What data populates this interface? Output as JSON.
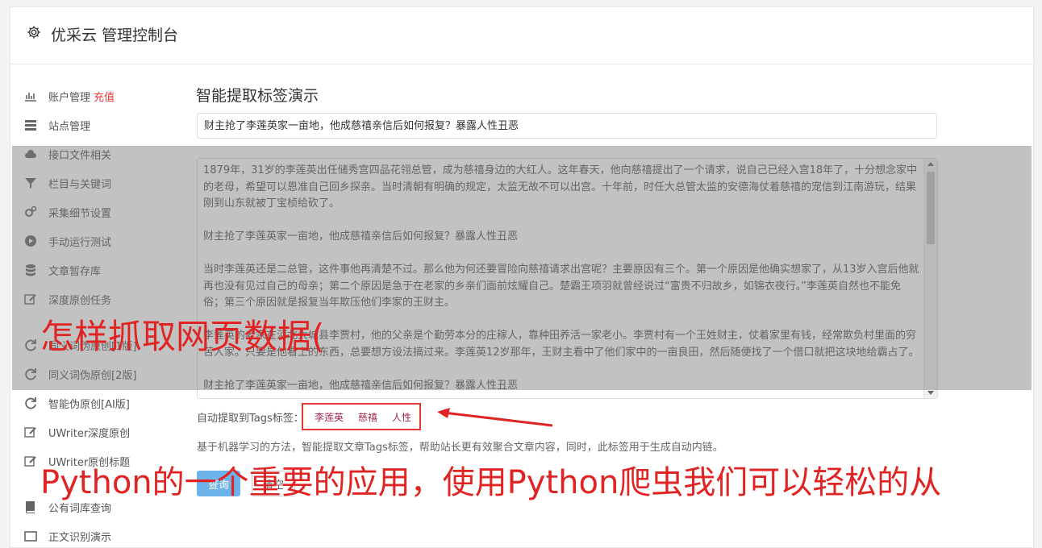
{
  "header": {
    "title": "优采云 管理控制台",
    "icon": "gear-icon"
  },
  "sidebar": {
    "items": [
      {
        "label": "账户管理",
        "extra": "充值",
        "icon": "bar-chart-icon"
      },
      {
        "label": "站点管理",
        "icon": "server-icon"
      },
      {
        "label": "接口文件相关",
        "icon": "cloud-upload-icon"
      },
      {
        "label": "栏目与关键词",
        "icon": "filter-icon"
      },
      {
        "label": "采集细节设置",
        "icon": "gears-icon"
      },
      {
        "label": "手动运行测试",
        "icon": "play-icon"
      },
      {
        "label": "文章暂存库",
        "icon": "database-icon"
      },
      {
        "label": "深度原创任务",
        "icon": "edit-icon"
      },
      {
        "label": "同义词伪原创[1版]",
        "icon": "refresh-icon"
      },
      {
        "label": "同义词伪原创[2版]",
        "icon": "refresh-icon"
      },
      {
        "label": "智能伪原创[AI版]",
        "icon": "refresh-icon"
      },
      {
        "label": "UWriter深度原创",
        "icon": "edit-icon"
      },
      {
        "label": "UWriter原创标题",
        "icon": "edit-icon"
      },
      {
        "label": "公有词库查询",
        "icon": "book-icon"
      },
      {
        "label": "正文识别演示",
        "icon": "window-icon"
      }
    ]
  },
  "main": {
    "title": "智能提取标签演示",
    "title_input_value": "财主抢了李莲英家一亩地，他成慈禧亲信后如何报复？暴露人性丑恶",
    "content_paragraphs": [
      "1879年，31岁的李莲英出任储秀宫四品花翎总管，成为慈禧身边的大红人。这年春天，他向慈禧提出了一个请求，说自己已经入宫18年了，十分想念家中的老母，希望可以恩准自己回乡探亲。当时清朝有明确的规定，太监无故不可以出宫。十年前，时任大总管太监的安德海仗着慈禧的宠信到江南游玩，结果刚到山东就被丁宝桢给砍了。",
      "财主抢了李莲英家一亩地，他成慈禧亲信后如何报复？暴露人性丑恶",
      "当时李莲英还是二总管，这件事他再清楚不过。那么他为何还要冒险向慈禧请求出宫呢？主要原因有三个。第一个原因是他确实想家了，从13岁入宫后他就再也没有见过自己的母亲；第二个原因是急于在老家的乡亲们面前炫耀自己。楚霸王项羽就曾经说过“富贵不归故乡，如锦衣夜行。”李莲英自然也不能免俗；第三个原因就是报复当年欺压他们李家的王财主。",
      "李莲英的老家在河北大城县李贾村，他的父亲是个勤劳本分的庄稼人，靠种田养活一家老小。李贾村有一个王姓财主，仗着家里有钱，经常欺负村里面的穷苦人家。只要是他看上的东西，总要想方设法搞过来。李莲英12岁那年，王财主看中了他们家中的一亩良田，然后随便找了一个借口就把这块地给霸占了。",
      "财主抢了李莲英家一亩地，他成慈禧亲信后如何报复？暴露人性丑恶"
    ],
    "tags_label": "自动提取到Tags标签：",
    "tags": [
      "李莲英",
      "慈禧",
      "人性"
    ],
    "description": "基于机器学习的方法，智能提取文章Tags标签，帮助站长更有效聚合文章内容，同时，此标签用于生成自动内链。",
    "query_button": "查询",
    "clear_button": "清空"
  },
  "overlay": {
    "line1": "怎样抓取网页数据(",
    "line2": "Python的一个重要的应用，使用Python爬虫我们可以轻松的从",
    "color": "#e02424"
  }
}
